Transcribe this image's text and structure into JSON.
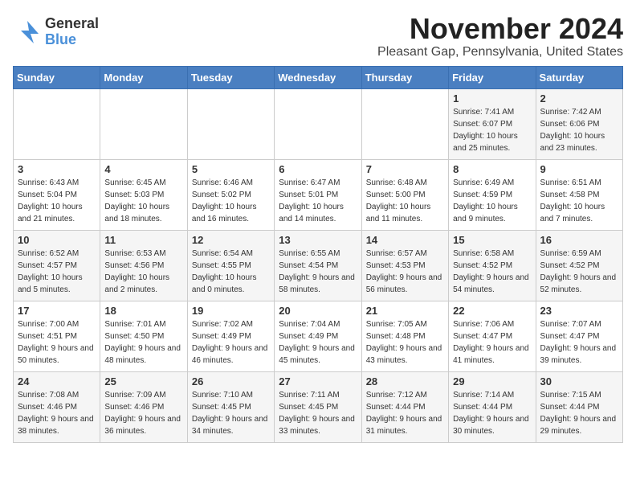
{
  "logo": {
    "general": "General",
    "blue": "Blue"
  },
  "title": "November 2024",
  "location": "Pleasant Gap, Pennsylvania, United States",
  "weekdays": [
    "Sunday",
    "Monday",
    "Tuesday",
    "Wednesday",
    "Thursday",
    "Friday",
    "Saturday"
  ],
  "weeks": [
    [
      {
        "day": "",
        "info": ""
      },
      {
        "day": "",
        "info": ""
      },
      {
        "day": "",
        "info": ""
      },
      {
        "day": "",
        "info": ""
      },
      {
        "day": "",
        "info": ""
      },
      {
        "day": "1",
        "info": "Sunrise: 7:41 AM\nSunset: 6:07 PM\nDaylight: 10 hours and 25 minutes."
      },
      {
        "day": "2",
        "info": "Sunrise: 7:42 AM\nSunset: 6:06 PM\nDaylight: 10 hours and 23 minutes."
      }
    ],
    [
      {
        "day": "3",
        "info": "Sunrise: 6:43 AM\nSunset: 5:04 PM\nDaylight: 10 hours and 21 minutes."
      },
      {
        "day": "4",
        "info": "Sunrise: 6:45 AM\nSunset: 5:03 PM\nDaylight: 10 hours and 18 minutes."
      },
      {
        "day": "5",
        "info": "Sunrise: 6:46 AM\nSunset: 5:02 PM\nDaylight: 10 hours and 16 minutes."
      },
      {
        "day": "6",
        "info": "Sunrise: 6:47 AM\nSunset: 5:01 PM\nDaylight: 10 hours and 14 minutes."
      },
      {
        "day": "7",
        "info": "Sunrise: 6:48 AM\nSunset: 5:00 PM\nDaylight: 10 hours and 11 minutes."
      },
      {
        "day": "8",
        "info": "Sunrise: 6:49 AM\nSunset: 4:59 PM\nDaylight: 10 hours and 9 minutes."
      },
      {
        "day": "9",
        "info": "Sunrise: 6:51 AM\nSunset: 4:58 PM\nDaylight: 10 hours and 7 minutes."
      }
    ],
    [
      {
        "day": "10",
        "info": "Sunrise: 6:52 AM\nSunset: 4:57 PM\nDaylight: 10 hours and 5 minutes."
      },
      {
        "day": "11",
        "info": "Sunrise: 6:53 AM\nSunset: 4:56 PM\nDaylight: 10 hours and 2 minutes."
      },
      {
        "day": "12",
        "info": "Sunrise: 6:54 AM\nSunset: 4:55 PM\nDaylight: 10 hours and 0 minutes."
      },
      {
        "day": "13",
        "info": "Sunrise: 6:55 AM\nSunset: 4:54 PM\nDaylight: 9 hours and 58 minutes."
      },
      {
        "day": "14",
        "info": "Sunrise: 6:57 AM\nSunset: 4:53 PM\nDaylight: 9 hours and 56 minutes."
      },
      {
        "day": "15",
        "info": "Sunrise: 6:58 AM\nSunset: 4:52 PM\nDaylight: 9 hours and 54 minutes."
      },
      {
        "day": "16",
        "info": "Sunrise: 6:59 AM\nSunset: 4:52 PM\nDaylight: 9 hours and 52 minutes."
      }
    ],
    [
      {
        "day": "17",
        "info": "Sunrise: 7:00 AM\nSunset: 4:51 PM\nDaylight: 9 hours and 50 minutes."
      },
      {
        "day": "18",
        "info": "Sunrise: 7:01 AM\nSunset: 4:50 PM\nDaylight: 9 hours and 48 minutes."
      },
      {
        "day": "19",
        "info": "Sunrise: 7:02 AM\nSunset: 4:49 PM\nDaylight: 9 hours and 46 minutes."
      },
      {
        "day": "20",
        "info": "Sunrise: 7:04 AM\nSunset: 4:49 PM\nDaylight: 9 hours and 45 minutes."
      },
      {
        "day": "21",
        "info": "Sunrise: 7:05 AM\nSunset: 4:48 PM\nDaylight: 9 hours and 43 minutes."
      },
      {
        "day": "22",
        "info": "Sunrise: 7:06 AM\nSunset: 4:47 PM\nDaylight: 9 hours and 41 minutes."
      },
      {
        "day": "23",
        "info": "Sunrise: 7:07 AM\nSunset: 4:47 PM\nDaylight: 9 hours and 39 minutes."
      }
    ],
    [
      {
        "day": "24",
        "info": "Sunrise: 7:08 AM\nSunset: 4:46 PM\nDaylight: 9 hours and 38 minutes."
      },
      {
        "day": "25",
        "info": "Sunrise: 7:09 AM\nSunset: 4:46 PM\nDaylight: 9 hours and 36 minutes."
      },
      {
        "day": "26",
        "info": "Sunrise: 7:10 AM\nSunset: 4:45 PM\nDaylight: 9 hours and 34 minutes."
      },
      {
        "day": "27",
        "info": "Sunrise: 7:11 AM\nSunset: 4:45 PM\nDaylight: 9 hours and 33 minutes."
      },
      {
        "day": "28",
        "info": "Sunrise: 7:12 AM\nSunset: 4:44 PM\nDaylight: 9 hours and 31 minutes."
      },
      {
        "day": "29",
        "info": "Sunrise: 7:14 AM\nSunset: 4:44 PM\nDaylight: 9 hours and 30 minutes."
      },
      {
        "day": "30",
        "info": "Sunrise: 7:15 AM\nSunset: 4:44 PM\nDaylight: 9 hours and 29 minutes."
      }
    ]
  ]
}
